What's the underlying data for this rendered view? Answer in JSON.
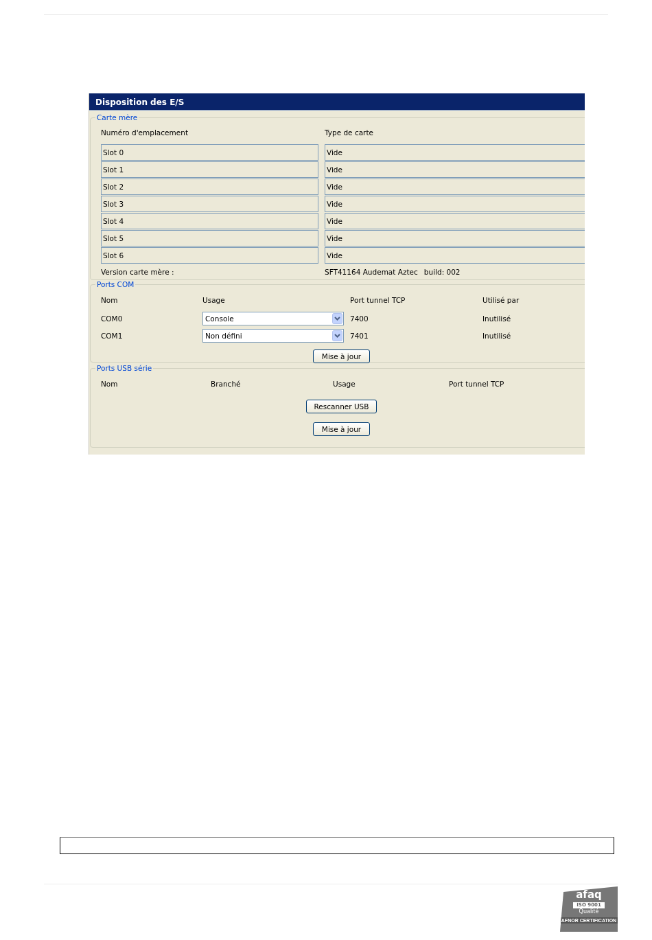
{
  "window": {
    "title": "Disposition des E/S"
  },
  "motherboard": {
    "legend": "Carte mère",
    "columns": [
      "Numéro d'emplacement",
      "Type de carte"
    ],
    "slots": [
      {
        "slot": "Slot 0",
        "type": "Vide"
      },
      {
        "slot": "Slot 1",
        "type": "Vide"
      },
      {
        "slot": "Slot 2",
        "type": "Vide"
      },
      {
        "slot": "Slot 3",
        "type": "Vide"
      },
      {
        "slot": "Slot 4",
        "type": "Vide"
      },
      {
        "slot": "Slot 5",
        "type": "Vide"
      },
      {
        "slot": "Slot 6",
        "type": "Vide"
      }
    ],
    "version_label": "Version carte mère :",
    "version_name": "SFT41164 Audemat Aztec",
    "build": "build: 002"
  },
  "com_ports": {
    "legend": "Ports COM",
    "columns": [
      "Nom",
      "Usage",
      "Port tunnel TCP",
      "Utilisé par"
    ],
    "rows": [
      {
        "name": "COM0",
        "usage": "Console",
        "tcp_port": "7400",
        "used_by": "Inutilisé"
      },
      {
        "name": "COM1",
        "usage": "Non défini",
        "tcp_port": "7401",
        "used_by": "Inutilisé"
      }
    ],
    "update_button": "Mise à jour"
  },
  "usb_ports": {
    "legend": "Ports USB série",
    "columns": [
      "Nom",
      "Branché",
      "Usage",
      "Port tunnel TCP"
    ],
    "rescan_button": "Rescanner USB",
    "update_button": "Mise à jour"
  },
  "footer_logo": {
    "brand": "afaq",
    "standard": "ISO 9001",
    "quality": "Qualité",
    "certifier": "AFNOR CERTIFICATION"
  }
}
